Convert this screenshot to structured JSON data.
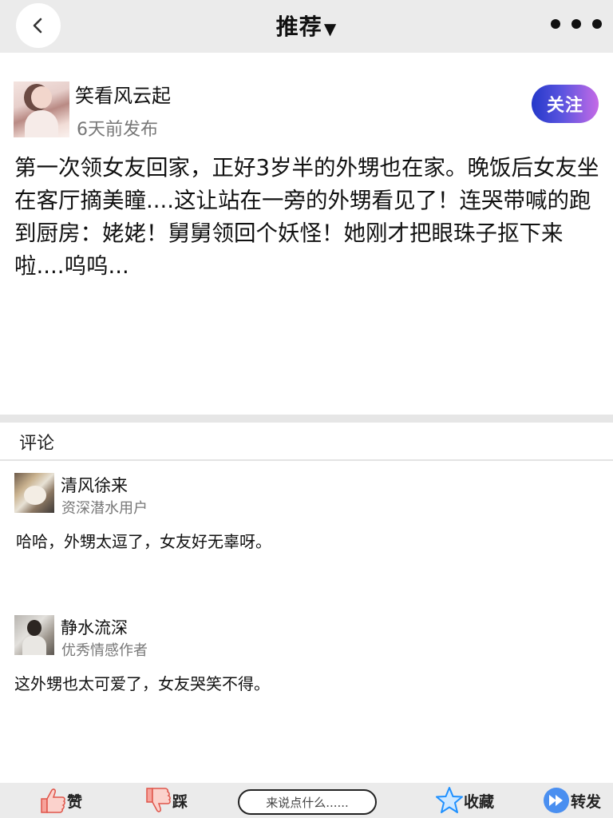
{
  "header": {
    "title": "推荐",
    "title_caret": "▼"
  },
  "post": {
    "author": "笑看风云起",
    "time": "6天前发布",
    "follow_label": "关注",
    "content": "第一次领女友回家，正好3岁半的外甥也在家。晚饭后女友坐在客厅摘美瞳....这让站在一旁的外甥看见了！连哭带喊的跑到厨房：姥姥！舅舅领回个妖怪！她刚才把眼珠子抠下来啦....呜呜..."
  },
  "comments": {
    "title": "评论",
    "items": [
      {
        "name": "清风徐来",
        "role": "资深潜水用户",
        "text": "哈哈，外甥太逗了，女友好无辜呀。"
      },
      {
        "name": "静水流深",
        "role": "优秀情感作者",
        "text": "这外甥也太可爱了，女友哭笑不得。"
      }
    ]
  },
  "bottom_bar": {
    "like_label": "赞",
    "dislike_label": "踩",
    "input_placeholder": "来说点什么......",
    "favorite_label": "收藏",
    "share_label": "转发"
  },
  "colors": {
    "follow_gradient_start": "#2438c9",
    "follow_gradient_end": "#c56ae6",
    "bar_background": "#ebebeb",
    "star_blue": "#1e90ff",
    "thumb_red": "#e0554a"
  },
  "icons": [
    "back-arrow-icon",
    "more-dots-icon",
    "thumbs-up-icon",
    "thumbs-down-icon",
    "star-icon",
    "forward-icon"
  ]
}
